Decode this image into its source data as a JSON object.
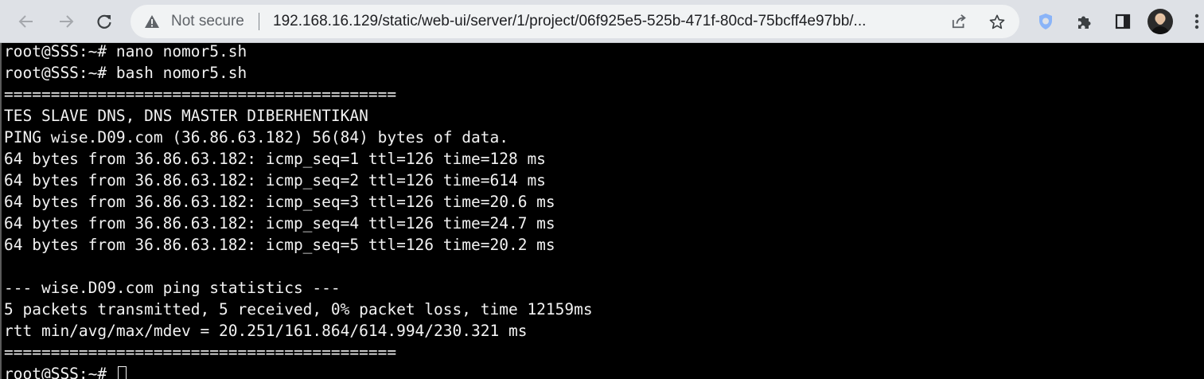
{
  "browser": {
    "security_label": "Not secure",
    "url": "192.168.16.129/static/web-ui/server/1/project/06f925e5-525b-471f-80cd-75bcff4e97bb/...",
    "icons": {
      "back": "arrow-left-icon",
      "forward": "arrow-right-icon",
      "reload": "reload-icon",
      "warning": "warning-triangle-icon",
      "share": "share-icon",
      "bookmark": "star-icon",
      "shield_extension": "shield-icon",
      "extensions": "puzzle-icon",
      "side_panel": "side-panel-icon",
      "menu": "kebab-menu-icon"
    },
    "colors": {
      "toolbar": "#dee1e6",
      "omnibox": "#f1f3f4",
      "shield": "#8ab4f8"
    }
  },
  "terminal": {
    "lines": [
      "root@SSS:~# nano nomor5.sh",
      "root@SSS:~# bash nomor5.sh",
      "==========================================",
      "TES SLAVE DNS, DNS MASTER DIBERHENTIKAN",
      "PING wise.D09.com (36.86.63.182) 56(84) bytes of data.",
      "64 bytes from 36.86.63.182: icmp_seq=1 ttl=126 time=128 ms",
      "64 bytes from 36.86.63.182: icmp_seq=2 ttl=126 time=614 ms",
      "64 bytes from 36.86.63.182: icmp_seq=3 ttl=126 time=20.6 ms",
      "64 bytes from 36.86.63.182: icmp_seq=4 ttl=126 time=24.7 ms",
      "64 bytes from 36.86.63.182: icmp_seq=5 ttl=126 time=20.2 ms",
      "",
      "--- wise.D09.com ping statistics ---",
      "5 packets transmitted, 5 received, 0% packet loss, time 12159ms",
      "rtt min/avg/max/mdev = 20.251/161.864/614.994/230.321 ms",
      "==========================================",
      "root@SSS:~# "
    ],
    "colors": {
      "background": "#000000",
      "foreground": "#f2f2f2"
    }
  }
}
